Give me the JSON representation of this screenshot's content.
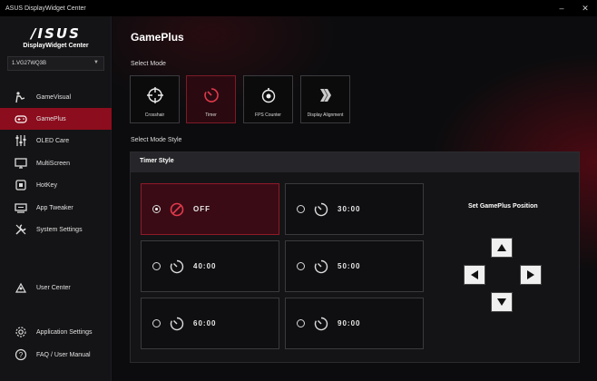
{
  "window": {
    "title": "ASUS DisplayWidget Center",
    "minimize": "–",
    "close": "✕"
  },
  "sidebar": {
    "brand": "/ISUS",
    "app_name": "DisplayWidget Center",
    "monitor_select": {
      "value": "1.VG27WQ3B"
    },
    "items": [
      {
        "label": "GameVisual",
        "icon": "gamevisual-icon"
      },
      {
        "label": "GamePlus",
        "icon": "gamepad-icon",
        "active": true
      },
      {
        "label": "OLED Care",
        "icon": "sliders-icon"
      },
      {
        "label": "MultiScreen",
        "icon": "monitor-icon"
      },
      {
        "label": "HotKey",
        "icon": "hotkey-icon"
      },
      {
        "label": "App Tweaker",
        "icon": "app-tweaker-icon"
      },
      {
        "label": "System Settings",
        "icon": "wrench-icon"
      }
    ],
    "user_center": {
      "label": "User Center",
      "icon": "user-center-icon"
    },
    "footer": [
      {
        "label": "Application Settings",
        "icon": "gear-icon"
      },
      {
        "label": "FAQ / User Manual",
        "icon": "help-icon"
      }
    ]
  },
  "main": {
    "title": "GamePlus",
    "select_mode_label": "Select Mode",
    "modes": [
      {
        "label": "Crosshair",
        "icon": "crosshair-icon"
      },
      {
        "label": "Timer",
        "icon": "timer-icon",
        "active": true
      },
      {
        "label": "FPS Counter",
        "icon": "fps-counter-icon"
      },
      {
        "label": "Display Alignment",
        "icon": "display-alignment-icon"
      }
    ],
    "select_mode_style_label": "Select Mode Style",
    "timer_style": {
      "header": "Timer Style",
      "options": [
        {
          "label": "OFF",
          "checked": true
        },
        {
          "label": "30:00",
          "checked": false
        },
        {
          "label": "40:00",
          "checked": false
        },
        {
          "label": "50:00",
          "checked": false
        },
        {
          "label": "60:00",
          "checked": false
        },
        {
          "label": "90:00",
          "checked": false
        }
      ]
    },
    "position": {
      "title": "Set GamePlus Position"
    }
  },
  "colors": {
    "accent": "#8c0d1d",
    "active_tile": "#2a0a10",
    "background": "#0c0c0e"
  }
}
